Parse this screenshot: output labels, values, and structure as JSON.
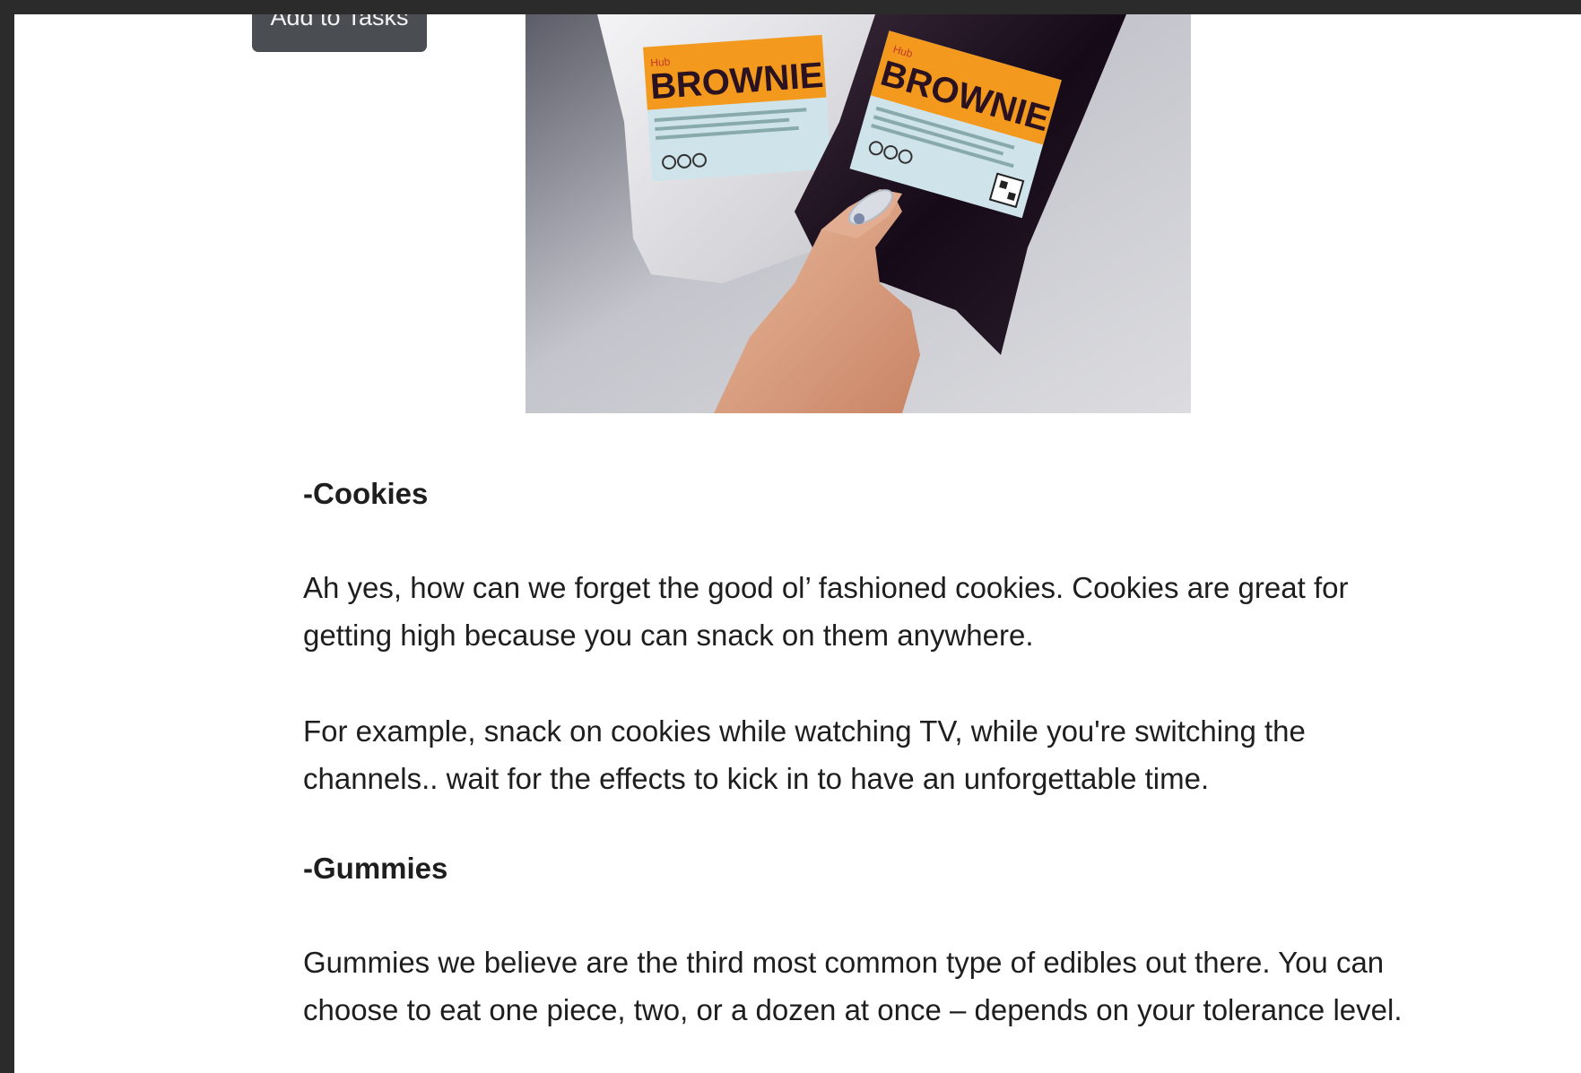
{
  "toolbar": {
    "add_to_tasks_label": "Add to Tasks"
  },
  "image": {
    "package_label": "BROWNIE",
    "brand_label": "Hub"
  },
  "article": {
    "cookies_heading": "-Cookies",
    "cookies_para_1": "Ah yes, how can we forget the good ol’ fashioned cookies. Cookies are great for getting high because you can snack on them anywhere.",
    "cookies_para_2": "For example, snack on cookies while watching TV, while you're switching the channels.. wait for the effects to kick in to have an unforgettable time.",
    "gummies_heading": "-Gummies",
    "gummies_para_1": "Gummies we believe are the third most common type of edibles out there. You can choose to eat one piece, two, or a dozen at once – depends on your tolerance level."
  },
  "colors": {
    "chrome": "#2b2b2b",
    "button_bg": "#4a4d52",
    "label_orange": "#f39a1e",
    "text": "#1e1e1e"
  }
}
